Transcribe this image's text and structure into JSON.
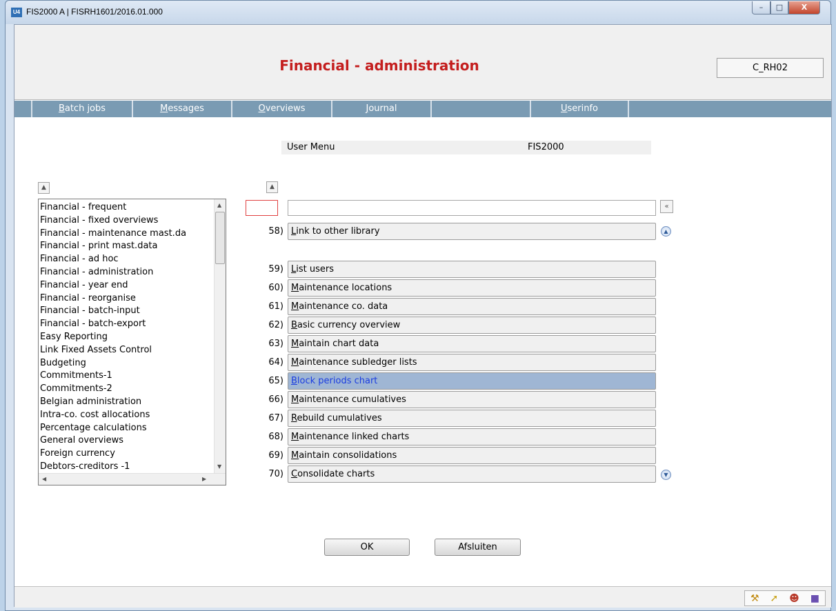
{
  "window": {
    "app_icon_text": "U4",
    "title": "FIS2000 A | FISRH1601/2016.01.000",
    "controls": {
      "minimize": "–",
      "maximize": "□",
      "close": "X"
    }
  },
  "header": {
    "title": "Financial - administration",
    "screen_code": "C_RH02"
  },
  "menubar": {
    "items": [
      {
        "label": "Batch jobs",
        "mnemonic": "B",
        "rest": "atch jobs"
      },
      {
        "label": "Messages",
        "mnemonic": "M",
        "rest": "essages"
      },
      {
        "label": "Overviews",
        "mnemonic": "O",
        "rest": "verviews"
      },
      {
        "label": "Journal",
        "mnemonic": "J",
        "rest": "ournal"
      },
      {
        "label": "",
        "mnemonic": "",
        "rest": ""
      },
      {
        "label": "Userinfo",
        "mnemonic": "U",
        "rest": "serinfo"
      }
    ]
  },
  "user_menu": {
    "label": "User Menu",
    "code": "FIS2000"
  },
  "menu_list": {
    "items": [
      "Financial - frequent",
      "Financial - fixed overviews",
      "Financial - maintenance mast.da",
      "Financial - print mast.data",
      "Financial - ad hoc",
      "Financial - administration",
      "Financial - year end",
      "Financial - reorganise",
      "Financial - batch-input",
      "Financial - batch-export",
      "Easy Reporting",
      "Link Fixed Assets Control",
      "Budgeting",
      "Commitments-1",
      "Commitments-2",
      "Belgian administration",
      "Intra-co. cost allocations",
      "Percentage calculations",
      "General overviews",
      "Foreign currency",
      "Debtors-creditors -1"
    ]
  },
  "command": {
    "value": "",
    "search_value": ""
  },
  "link_option": {
    "number": "58)",
    "mnemonic": "L",
    "rest": "ink to other library"
  },
  "options": [
    {
      "number": "59)",
      "mnemonic": "L",
      "rest": "ist users",
      "selected": false
    },
    {
      "number": "60)",
      "mnemonic": "M",
      "rest": "aintenance locations",
      "selected": false
    },
    {
      "number": "61)",
      "mnemonic": "M",
      "rest": "aintenance co. data",
      "selected": false
    },
    {
      "number": "62)",
      "mnemonic": "B",
      "rest": "asic currency overview",
      "selected": false
    },
    {
      "number": "63)",
      "mnemonic": "M",
      "rest": "aintain chart data",
      "selected": false
    },
    {
      "number": "64)",
      "mnemonic": "M",
      "rest": "aintenance subledger lists",
      "selected": false
    },
    {
      "number": "65)",
      "mnemonic": "B",
      "rest": "lock periods chart",
      "selected": true
    },
    {
      "number": "66)",
      "mnemonic": "M",
      "rest": "aintenance cumulatives",
      "selected": false
    },
    {
      "number": "67)",
      "mnemonic": "R",
      "rest": "ebuild cumulatives",
      "selected": false
    },
    {
      "number": "68)",
      "mnemonic": "M",
      "rest": "aintenance linked charts",
      "selected": false
    },
    {
      "number": "69)",
      "mnemonic": "M",
      "rest": "aintain consolidations",
      "selected": false
    },
    {
      "number": "70)",
      "mnemonic": "C",
      "rest": "onsolidate charts",
      "selected": false
    }
  ],
  "footer": {
    "ok_label": "OK",
    "exit_label": "Afsluiten"
  },
  "status_icons": [
    "tools-icon",
    "pin-icon",
    "user-icon",
    "box-icon"
  ]
}
